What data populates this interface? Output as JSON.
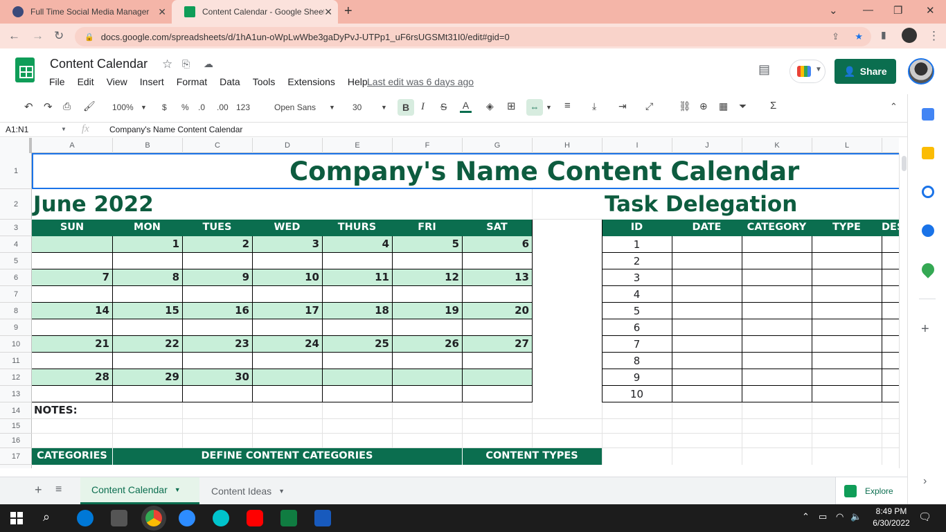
{
  "browser": {
    "tabs": [
      {
        "title": "Full Time Social Media Manager (",
        "active": false
      },
      {
        "title": "Content Calendar - Google Sheets",
        "active": true
      }
    ],
    "url": "docs.google.com/spreadsheets/d/1hA1un-oWpLwWbe3gaDyPvJ-UTPp1_uF6rsUGSMt31I0/edit#gid=0"
  },
  "doc": {
    "title": "Content Calendar",
    "menu": [
      "File",
      "Edit",
      "View",
      "Insert",
      "Format",
      "Data",
      "Tools",
      "Extensions",
      "Help"
    ],
    "last_edit": "Last edit was 6 days ago",
    "share_label": "Share"
  },
  "toolbar": {
    "zoom": "100%",
    "currency": "$",
    "percent": "%",
    "dec_decrease": ".0",
    "dec_increase": ".00",
    "format_more": "123",
    "font": "Open Sans",
    "font_size": "30",
    "bold": "B",
    "italic": "I",
    "strike": "S",
    "text_color": "A"
  },
  "formula_bar": {
    "name_box": "A1:N1",
    "fx": "fx",
    "content": "Company's Name Content Calendar"
  },
  "columns": [
    "A",
    "B",
    "C",
    "D",
    "E",
    "F",
    "G",
    "H",
    "I",
    "J",
    "K",
    "L"
  ],
  "rows": [
    "1",
    "2",
    "3",
    "4",
    "5",
    "6",
    "7",
    "8",
    "9",
    "10",
    "11",
    "12",
    "13",
    "14",
    "15",
    "16",
    "17"
  ],
  "sheet": {
    "main_title": "Company's Name Content Calendar",
    "month_title": "June 2022",
    "task_title": "Task Delegation",
    "weekdays": [
      "SUN",
      "MON",
      "TUES",
      "WED",
      "THURS",
      "FRI",
      "SAT"
    ],
    "weeks": [
      [
        "",
        "1",
        "2",
        "3",
        "4",
        "5",
        "6"
      ],
      [
        "7",
        "8",
        "9",
        "10",
        "11",
        "12",
        "13"
      ],
      [
        "14",
        "15",
        "16",
        "17",
        "18",
        "19",
        "20"
      ],
      [
        "21",
        "22",
        "23",
        "24",
        "25",
        "26",
        "27"
      ],
      [
        "28",
        "29",
        "30",
        "",
        "",
        "",
        ""
      ]
    ],
    "task_headers": [
      "ID",
      "DATE",
      "CATEGORY",
      "TYPE",
      "DES"
    ],
    "task_ids": [
      "1",
      "2",
      "3",
      "4",
      "5",
      "6",
      "7",
      "8",
      "9",
      "10"
    ],
    "notes_label": "NOTES:",
    "bottom_headers": [
      "CATEGORIES",
      "DEFINE CONTENT CATEGORIES",
      "CONTENT TYPES"
    ]
  },
  "sheet_tabs": [
    {
      "label": "Content Calendar",
      "active": true
    },
    {
      "label": "Content Ideas",
      "active": false
    }
  ],
  "explore_label": "Explore",
  "taskbar": {
    "time": "8:49 PM",
    "date": "6/30/2022"
  },
  "colors": {
    "accent": "#0b6e4f",
    "light_green": "#c8efd9",
    "title_green": "#0d5c3f"
  }
}
